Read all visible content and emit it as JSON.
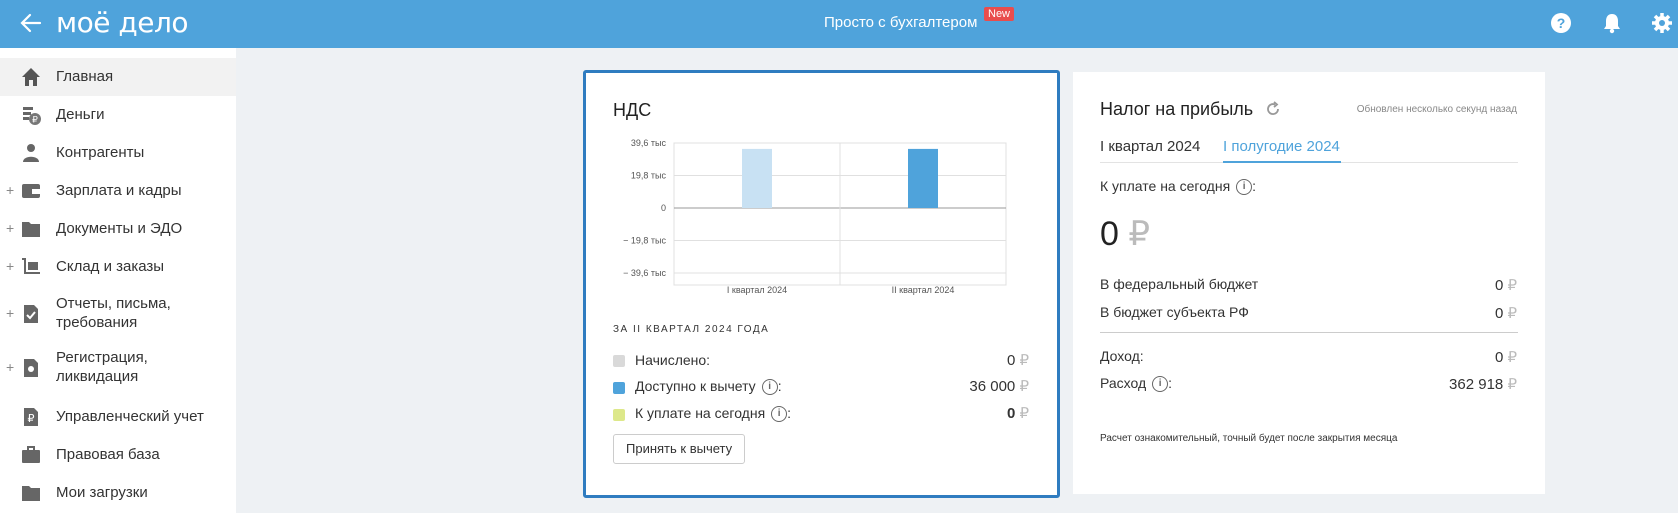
{
  "header": {
    "logo": "моё дело",
    "center_title": "Просто с бухгалтером",
    "badge": "New",
    "icons": [
      "back-arrow-icon",
      "help-icon",
      "bell-icon",
      "gear-icon"
    ],
    "bg_color": "#4fa3db"
  },
  "sidebar": {
    "items": [
      {
        "label": "Главная",
        "icon": "home-icon",
        "expandable": false,
        "active": true
      },
      {
        "label": "Деньги",
        "icon": "money-icon",
        "expandable": false
      },
      {
        "label": "Контрагенты",
        "icon": "contractors-icon",
        "expandable": false
      },
      {
        "label": "Зарплата и кадры",
        "icon": "wallet-icon",
        "expandable": true
      },
      {
        "label": "Документы и ЭДО",
        "icon": "folder-icon",
        "expandable": true
      },
      {
        "label": "Склад и заказы",
        "icon": "warehouse-icon",
        "expandable": true
      },
      {
        "label": "Отчеты, письма, требования",
        "label_line1": "Отчеты, письма,",
        "label_line2": "требования",
        "icon": "report-icon",
        "expandable": true
      },
      {
        "label": "Регистрация, ликвидация",
        "label_line1": "Регистрация,",
        "label_line2": "ликвидация",
        "icon": "registration-icon",
        "expandable": true
      },
      {
        "label": "Управленческий учет",
        "icon": "ruble-doc-icon",
        "expandable": false
      },
      {
        "label": "Правовая база",
        "icon": "briefcase-icon",
        "expandable": false
      },
      {
        "label": "Мои загрузки",
        "icon": "folder-icon",
        "expandable": false
      }
    ]
  },
  "nds": {
    "title": "НДС",
    "period_caption": "ЗА II КВАРТАЛ 2024 ГОДА",
    "rows": [
      {
        "label": "Начислено:",
        "value": "0",
        "currency": "₽",
        "color": "#d9d9d9",
        "info": false
      },
      {
        "label": "Доступно к вычету",
        "value": "36 000",
        "currency": "₽",
        "color": "#4fa3db",
        "info": true
      },
      {
        "label": "К уплате на сегодня",
        "value": "0",
        "currency": "₽",
        "color": "#dde88a",
        "info": true
      }
    ],
    "button": "Принять к вычету"
  },
  "chart_data": {
    "type": "bar",
    "categories": [
      "I квартал 2024",
      "II квартал 2024"
    ],
    "series": [
      {
        "values": [
          36000,
          36000
        ],
        "colors": [
          "#c8e1f3",
          "#4fa3db"
        ]
      }
    ],
    "y_ticks": [
      "39,6 тыс",
      "19,8 тыс",
      "0",
      "− 19,8 тыс",
      "− 39,6 тыс"
    ],
    "ylim": [
      -39600,
      39600
    ],
    "grid": true
  },
  "profit": {
    "title": "Налог на прибыль",
    "updated": "Обновлен несколько секунд назад",
    "tabs": [
      {
        "label": "I квартал 2024",
        "active": false
      },
      {
        "label": "I полугодие 2024",
        "active": true
      }
    ],
    "due_label": "К уплате на сегодня",
    "due_value": "0",
    "currency": "₽",
    "budget_rows": [
      {
        "label": "В федеральный бюджет",
        "value": "0"
      },
      {
        "label": "В бюджет субъекта РФ",
        "value": "0"
      }
    ],
    "income_label": "Доход:",
    "income_value": "0",
    "expense_label": "Расход",
    "expense_value": "362 918",
    "note": "Расчет ознакомительный, точный будет после закрытия месяца",
    "accent_color": "#4fa3db"
  }
}
